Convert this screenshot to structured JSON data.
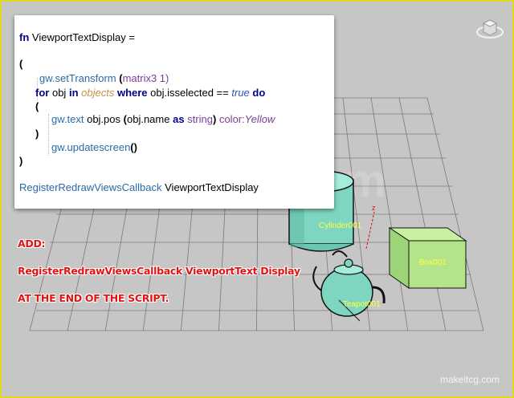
{
  "code": {
    "line1_kw": "fn",
    "line1_name": "ViewportTextDisplay =",
    "open_paren": "(",
    "settransform_fn": "gw.setTransform",
    "settransform_arg_open": "(",
    "settransform_arg": "matrix3 1",
    "settransform_arg_close": ")",
    "for_kw": "for",
    "for_var": "obj",
    "in_kw": "in",
    "objects": "objects",
    "where_kw": "where",
    "condition": "obj.isselected ==",
    "true_kw": "true",
    "do_kw": "do",
    "inner_open": "(",
    "gwtext_fn": "gw.text",
    "gwtext_arg1": "obj.pos",
    "gwtext_paren_open": "(",
    "gwtext_arg2": "obj.name",
    "as_kw": "as",
    "string_kw": "string",
    "gwtext_paren_close": ")",
    "color_kw": "color:",
    "color_val": "Yellow",
    "inner_close": ")",
    "update_fn": "gw.updatescreen",
    "update_parens": "()",
    "close_paren": ")",
    "register_fn": "RegisterRedrawViewsCallback",
    "register_arg": "ViewportTextDisplay"
  },
  "note": {
    "line1": "ADD:",
    "line2": "RegisterRedrawViewsCallback ViewportText Display",
    "line3": "AT THE END OF THE SCRIPT."
  },
  "scene": {
    "cylinder_label": "Cylinder001",
    "box_label": "Box001",
    "teapot_label": "Teapot001",
    "axis_z": "z"
  },
  "watermark": {
    "big": "makeitcg.com",
    "small": "makeitcg.com"
  },
  "colors": {
    "viewport_bg": "#c6c6c6",
    "border": "#e4d81c",
    "object_mint": "#7fd6c0",
    "box_green": "#b4e48a",
    "note_red": "#e11414",
    "label_yellow": "#ffff40"
  },
  "icons": {
    "viewcube": "viewcube-icon"
  }
}
